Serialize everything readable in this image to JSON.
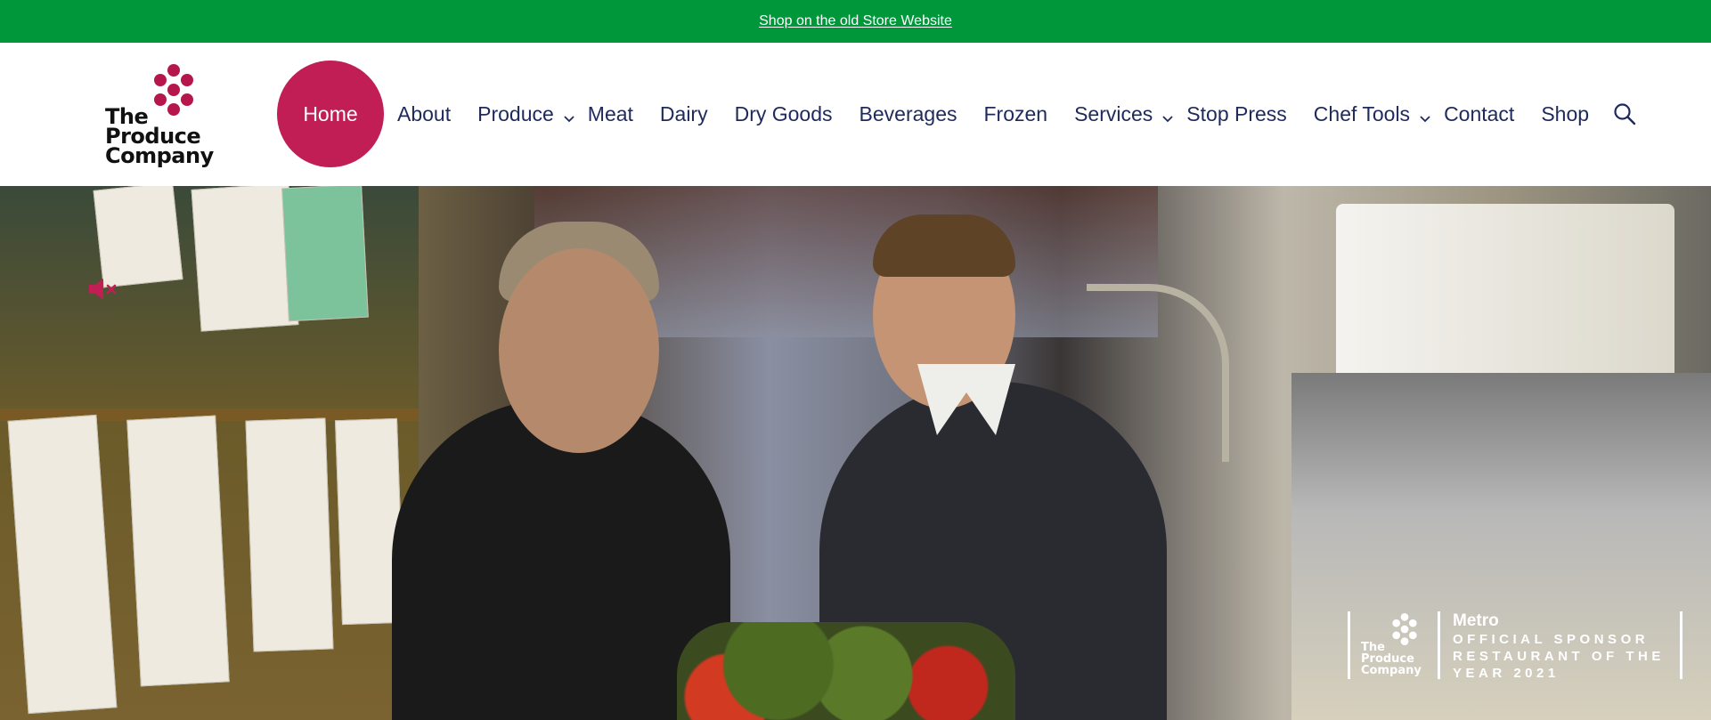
{
  "topbar": {
    "link_text": "Shop on the old Store Website",
    "background": "#00963a"
  },
  "logo": {
    "line1": "The",
    "line2": "Produce",
    "line3": "Company",
    "dot_color": "#b5174d"
  },
  "nav": {
    "home": "Home",
    "items": {
      "about": "About",
      "produce": "Produce",
      "meat": "Meat",
      "dairy": "Dairy",
      "dry_goods": "Dry Goods",
      "beverages": "Beverages",
      "frozen": "Frozen",
      "services": "Services",
      "stop_press": "Stop Press",
      "chef_tools": "Chef Tools",
      "contact": "Contact",
      "shop": "Shop"
    },
    "accent": "#c01e55",
    "icons": [
      "chevron-down-icon",
      "search-icon"
    ]
  },
  "hero": {
    "mute_icon": "mute-icon",
    "badge": {
      "logo_line1": "The",
      "logo_line2": "Produce",
      "logo_line3": "Company",
      "brand": "Metro",
      "line1": "OFFICIAL SPONSOR",
      "line2": "RESTAURANT OF THE",
      "line3": "YEAR 2021"
    }
  }
}
